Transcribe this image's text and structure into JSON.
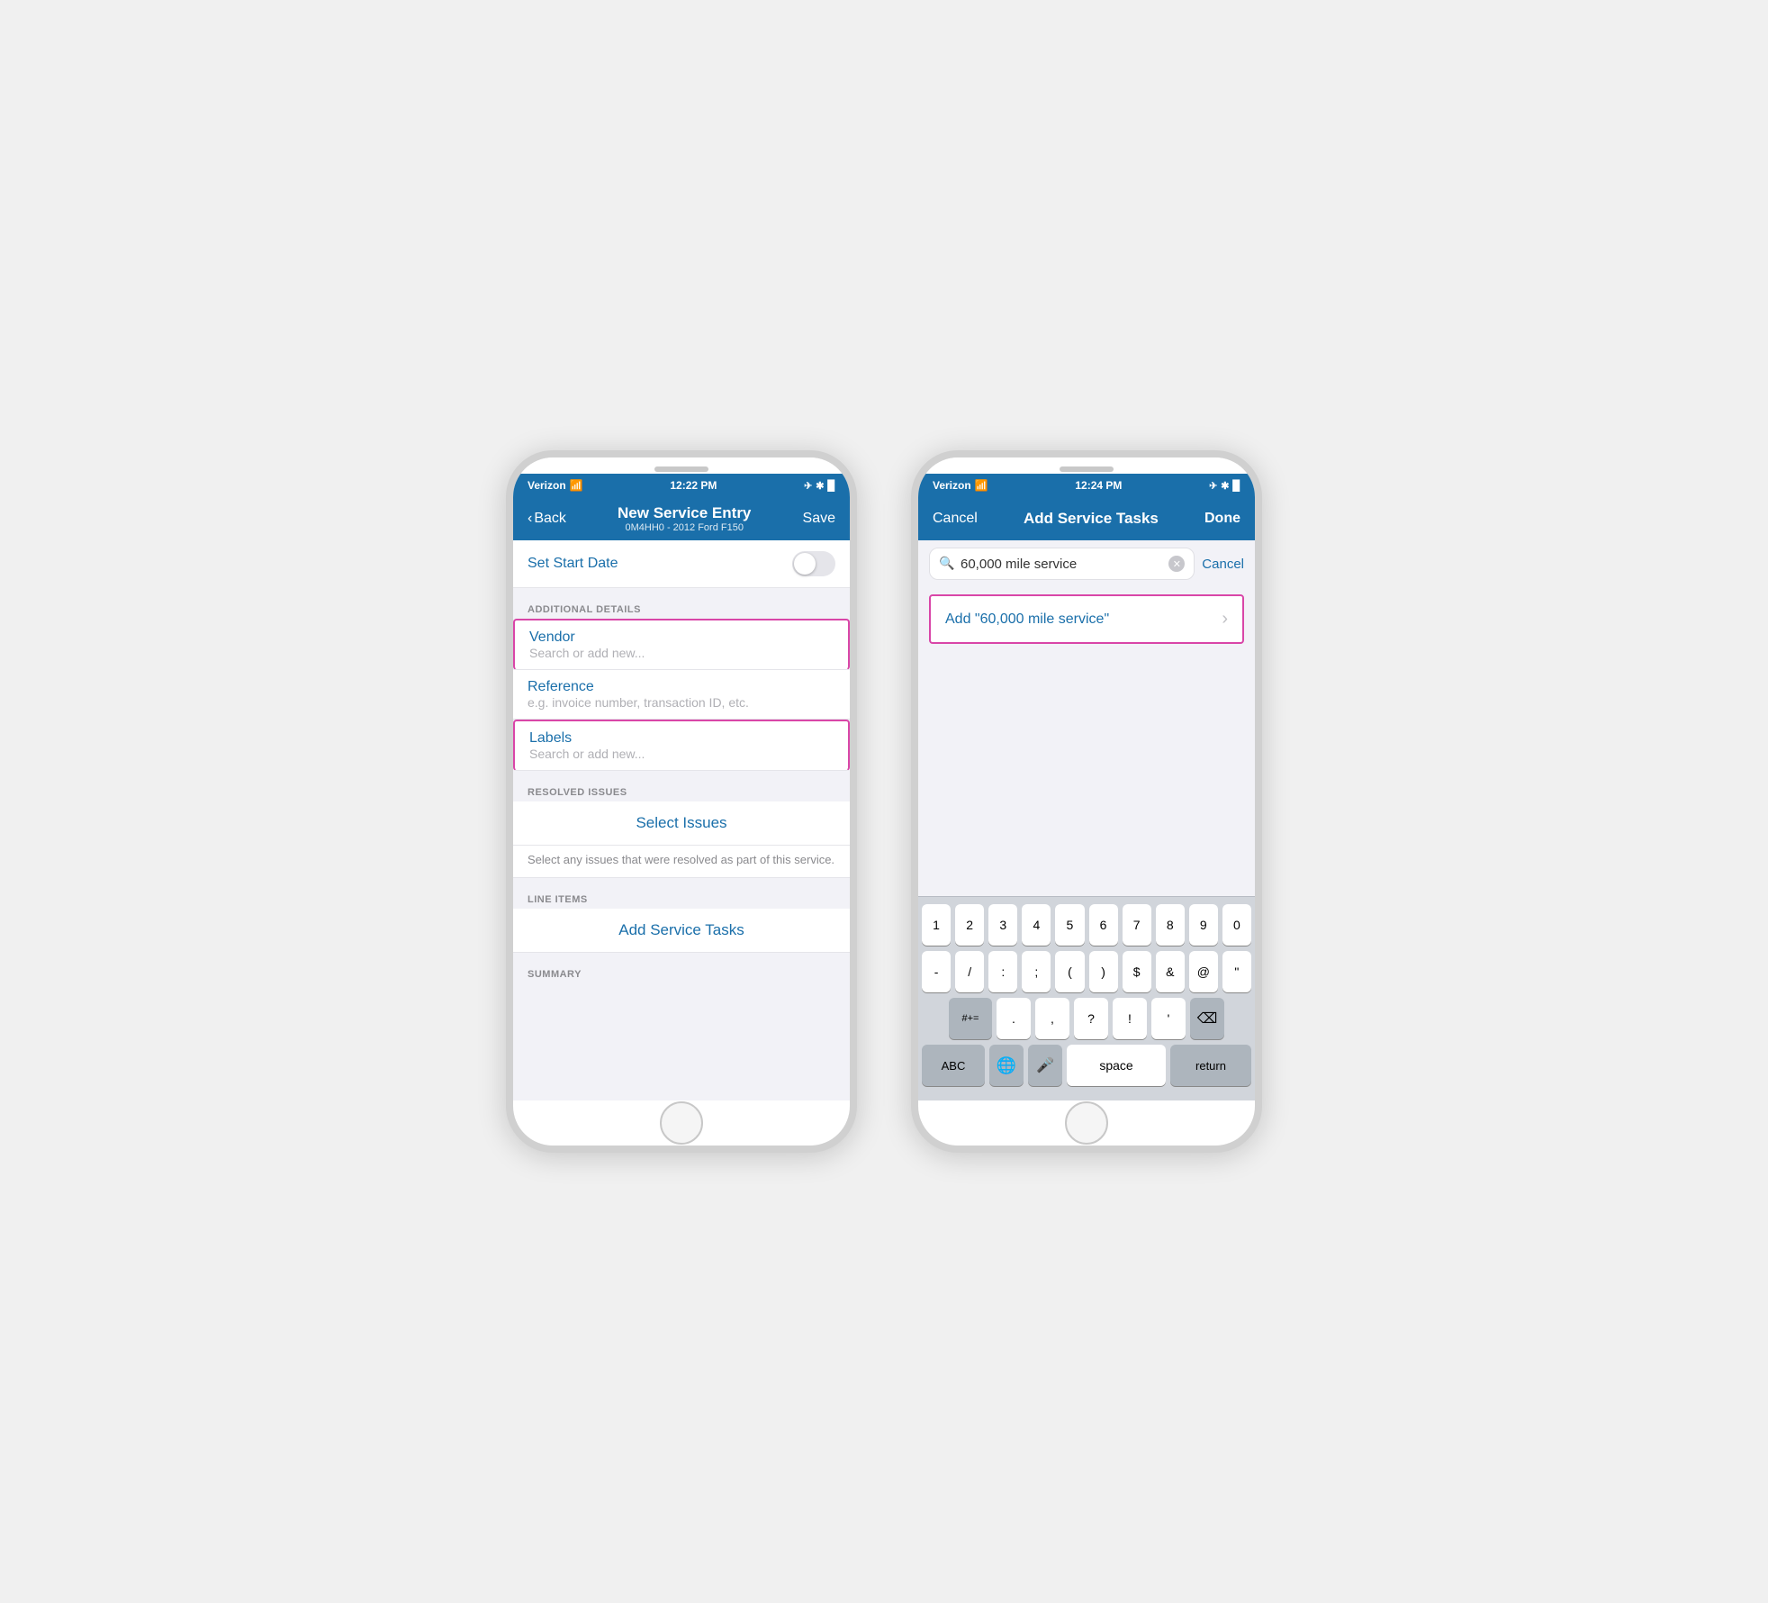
{
  "phone1": {
    "statusBar": {
      "carrier": "Verizon",
      "wifi": "📶",
      "time": "12:22 PM",
      "bluetooth": "✱",
      "battery": "🔋"
    },
    "navBar": {
      "backLabel": "Back",
      "title": "New Service Entry",
      "subtitle": "0M4HH0 - 2012 Ford F150",
      "saveLabel": "Save"
    },
    "startDate": {
      "label": "Set Start Date"
    },
    "additionalDetails": {
      "sectionHeader": "ADDITIONAL DETAILS",
      "vendor": {
        "label": "Vendor",
        "placeholder": "Search or add new..."
      },
      "reference": {
        "label": "Reference",
        "placeholder": "e.g. invoice number, transaction ID, etc."
      },
      "labels": {
        "label": "Labels",
        "placeholder": "Search or add new..."
      }
    },
    "resolvedIssues": {
      "sectionHeader": "RESOLVED ISSUES",
      "buttonLabel": "Select Issues",
      "helperText": "Select any issues that were resolved as part of this service."
    },
    "lineItems": {
      "sectionHeader": "LINE ITEMS",
      "buttonLabel": "Add Service Tasks"
    },
    "summary": {
      "sectionHeader": "SUMMARY"
    }
  },
  "phone2": {
    "statusBar": {
      "carrier": "Verizon",
      "time": "12:24 PM"
    },
    "navBar": {
      "cancelLabel": "Cancel",
      "title": "Add Service Tasks",
      "doneLabel": "Done"
    },
    "search": {
      "placeholder": "60,000 mile service",
      "cancelLabel": "Cancel"
    },
    "addResult": {
      "text": "Add \"60,000 mile service\"",
      "chevron": "›"
    },
    "keyboard": {
      "row1": [
        "1",
        "2",
        "3",
        "4",
        "5",
        "6",
        "7",
        "8",
        "9",
        "0"
      ],
      "row2": [
        "-",
        "/",
        ":",
        ";",
        "(",
        ")",
        "$",
        "&",
        "@",
        "\""
      ],
      "row3": [
        "#+=",
        ".",
        ",",
        "?",
        "!",
        "'",
        "⌫"
      ],
      "row4": [
        "ABC",
        "🌐",
        "🎤",
        "space",
        "return"
      ]
    }
  }
}
